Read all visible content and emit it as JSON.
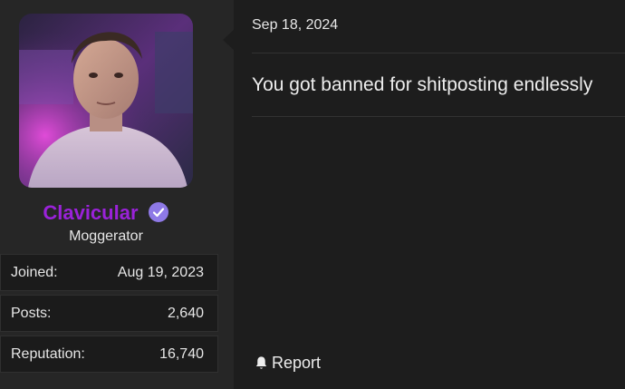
{
  "post": {
    "date": "Sep 18, 2024",
    "message": "You got banned for shitposting endlessly"
  },
  "user": {
    "username": "Clavicular",
    "title": "Moggerator",
    "username_color": "#9a22d9",
    "verified_color": "#8e79e6",
    "stats": [
      {
        "label": "Joined:",
        "value": "Aug 19, 2023"
      },
      {
        "label": "Posts:",
        "value": "2,640"
      },
      {
        "label": "Reputation:",
        "value": "16,740"
      }
    ]
  },
  "actions": {
    "report_label": "Report",
    "report_icon": "bell-icon"
  }
}
